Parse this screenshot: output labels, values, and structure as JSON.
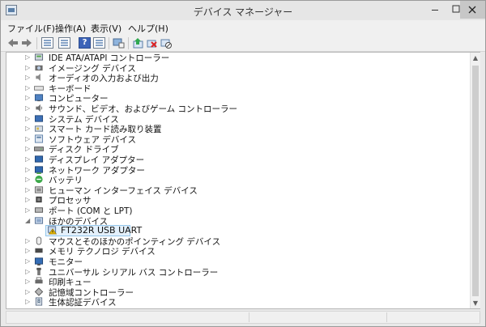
{
  "window": {
    "title": "デバイス マネージャー"
  },
  "menu": [
    {
      "label": "ファイル(F)"
    },
    {
      "label": "操作(A)"
    },
    {
      "label": "表示(V)"
    },
    {
      "label": "ヘルプ(H)"
    }
  ],
  "toolbar_icons": [
    "back-arrow-icon",
    "forward-arrow-icon",
    "show-hide-console-tree-icon",
    "properties-icon",
    "help-icon",
    "action-pane-icon",
    "scan-hardware-changes-icon",
    "update-driver-icon",
    "uninstall-device-icon",
    "disable-device-icon"
  ],
  "tree": {
    "items": [
      {
        "label": "IDE ATA/ATAPI コントローラー",
        "icon": "ide-controller-icon",
        "expanded": false
      },
      {
        "label": "イメージング デバイス",
        "icon": "camera-icon",
        "expanded": false
      },
      {
        "label": "オーディオの入力および出力",
        "icon": "audio-icon",
        "expanded": false
      },
      {
        "label": "キーボード",
        "icon": "keyboard-icon",
        "expanded": false
      },
      {
        "label": "コンピューター",
        "icon": "computer-icon",
        "expanded": false
      },
      {
        "label": "サウンド、ビデオ、およびゲーム コントローラー",
        "icon": "sound-icon",
        "expanded": false
      },
      {
        "label": "システム デバイス",
        "icon": "system-device-icon",
        "expanded": false
      },
      {
        "label": "スマート カード読み取り装置",
        "icon": "smart-card-reader-icon",
        "expanded": false
      },
      {
        "label": "ソフトウェア デバイス",
        "icon": "software-device-icon",
        "expanded": false
      },
      {
        "label": "ディスク ドライブ",
        "icon": "disk-drive-icon",
        "expanded": false
      },
      {
        "label": "ディスプレイ アダプター",
        "icon": "display-adapter-icon",
        "expanded": false
      },
      {
        "label": "ネットワーク アダプター",
        "icon": "network-adapter-icon",
        "expanded": false
      },
      {
        "label": "バッテリ",
        "icon": "battery-icon",
        "expanded": false
      },
      {
        "label": "ヒューマン インターフェイス デバイス",
        "icon": "hid-icon",
        "expanded": false
      },
      {
        "label": "プロセッサ",
        "icon": "processor-icon",
        "expanded": false
      },
      {
        "label": "ポート (COM と LPT)",
        "icon": "port-icon",
        "expanded": false
      },
      {
        "label": "ほかのデバイス",
        "icon": "other-devices-icon",
        "expanded": true
      },
      {
        "label": "FT232R USB UART",
        "icon": "warning-device-icon",
        "child": true,
        "selected": true
      },
      {
        "label": "マウスとそのほかのポインティング デバイス",
        "icon": "mouse-icon",
        "expanded": false
      },
      {
        "label": "メモリ テクノロジ デバイス",
        "icon": "memory-icon",
        "expanded": false
      },
      {
        "label": "モニター",
        "icon": "monitor-icon",
        "expanded": false
      },
      {
        "label": "ユニバーサル シリアル バス コントローラー",
        "icon": "usb-controller-icon",
        "expanded": false
      },
      {
        "label": "印刷キュー",
        "icon": "printer-icon",
        "expanded": false
      },
      {
        "label": "記憶域コントローラー",
        "icon": "storage-controller-icon",
        "expanded": false
      },
      {
        "label": "生体認証デバイス",
        "icon": "biometric-icon",
        "expanded": false
      }
    ]
  },
  "colors": {
    "selection_fill": "#e3f0fb",
    "selection_border": "#92c5ea",
    "warning": "#e6b800"
  }
}
